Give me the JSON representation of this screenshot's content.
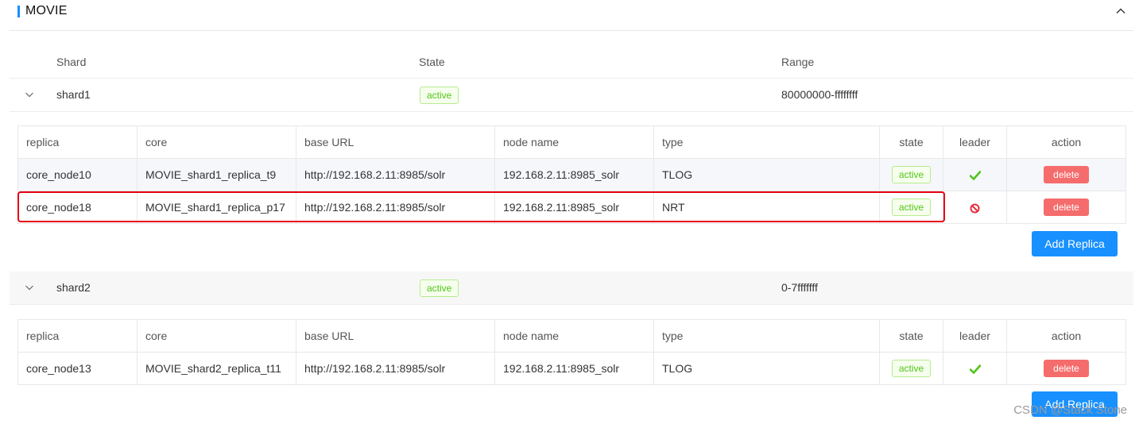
{
  "collection": {
    "title": "MOVIE",
    "accent_color": "#1890ff",
    "collapse_icon": "chevron-up-icon"
  },
  "shard_columns": [
    "Shard",
    "State",
    "Range"
  ],
  "replica_columns": [
    "replica",
    "core",
    "base URL",
    "node name",
    "type",
    "state",
    "leader",
    "action"
  ],
  "shards": [
    {
      "name": "shard1",
      "state": "active",
      "range": "80000000-ffffffff",
      "expand_icon": "chevron-down-icon",
      "replicas": [
        {
          "replica": "core_node10",
          "core": "MOVIE_shard1_replica_t9",
          "base_url": "http://192.168.2.11:8985/solr",
          "node_name": "192.168.2.11:8985_solr",
          "type": "TLOG",
          "state": "active",
          "leader_icon": "check-icon",
          "action": "delete"
        },
        {
          "replica": "core_node18",
          "core": "MOVIE_shard1_replica_p17",
          "base_url": "http://192.168.2.11:8985/solr",
          "node_name": "192.168.2.11:8985_solr",
          "type": "NRT",
          "state": "active",
          "leader_icon": "ban-icon",
          "action": "delete"
        }
      ],
      "add_replica_label": "Add Replica"
    },
    {
      "name": "shard2",
      "state": "active",
      "range": "0-7fffffff",
      "expand_icon": "chevron-down-icon",
      "replicas": [
        {
          "replica": "core_node13",
          "core": "MOVIE_shard2_replica_t11",
          "base_url": "http://192.168.2.11:8985/solr",
          "node_name": "192.168.2.11:8985_solr",
          "type": "TLOG",
          "state": "active",
          "leader_icon": "check-icon",
          "action": "delete"
        }
      ],
      "add_replica_label": "Add Replica"
    }
  ],
  "colors": {
    "active_text": "#52c41a",
    "delete_button": "#f56c6c",
    "add_button": "#1890ff",
    "leader_check": "#52c41a",
    "not_leader": "#e0313e",
    "highlight_box": "#e60012"
  },
  "watermark": "CSDN @Stack Stone"
}
